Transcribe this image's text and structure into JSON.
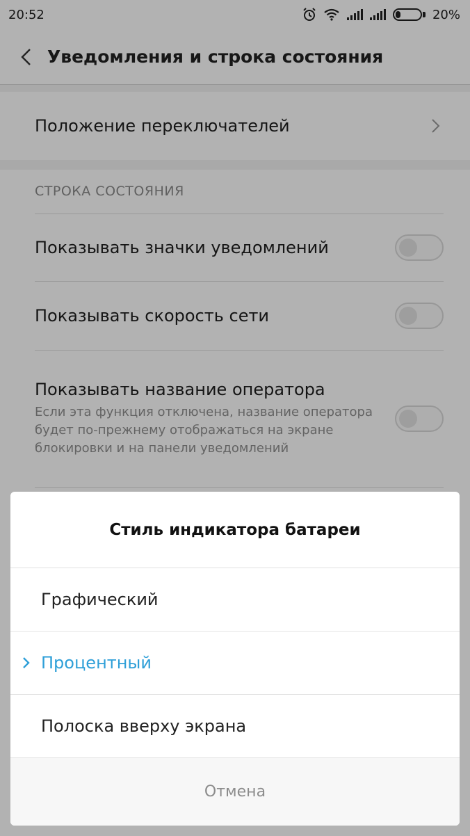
{
  "status": {
    "time": "20:52",
    "battery": "20%"
  },
  "header": {
    "title": "Уведомления и строка состояния"
  },
  "settings": {
    "toggle_position": "Положение переключателей",
    "section_status_bar": "СТРОКА СОСТОЯНИЯ",
    "show_notification_icons": "Показывать значки уведомлений",
    "show_network_speed": "Показывать скорость сети",
    "show_carrier_name": "Показывать название оператора",
    "carrier_desc": "Если эта функция отключена, название оператора будет по-прежнему отображаться на экране блокировки и на панели уведомлений"
  },
  "dialog": {
    "title": "Стиль индикатора батареи",
    "options": [
      "Графический",
      "Процентный",
      "Полоска вверху экрана"
    ],
    "selected": "Процентный",
    "cancel": "Отмена"
  },
  "colors": {
    "accent": "#2e9fd8"
  }
}
